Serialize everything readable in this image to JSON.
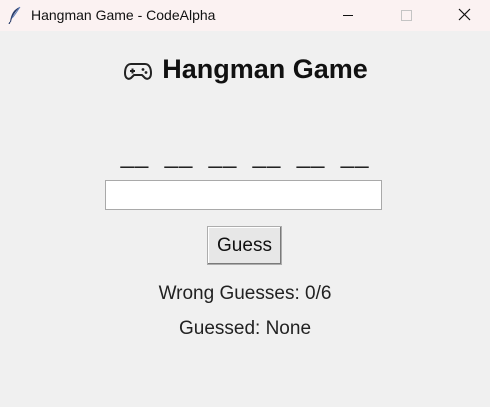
{
  "window": {
    "title": "Hangman Game - CodeAlpha",
    "app_icon": "feather-icon",
    "controls": {
      "minimize_icon": "minimize-icon",
      "maximize_icon": "maximize-icon",
      "close_icon": "close-icon"
    }
  },
  "game": {
    "heading_icon": "game-controller-icon",
    "heading": "Hangman Game",
    "word_display": "__  __  __  __  __  __",
    "input": {
      "value": "",
      "placeholder": ""
    },
    "guess_button_label": "Guess",
    "wrong_guesses": "Wrong Guesses: 0/6",
    "guessed_letters": "Guessed: None"
  }
}
